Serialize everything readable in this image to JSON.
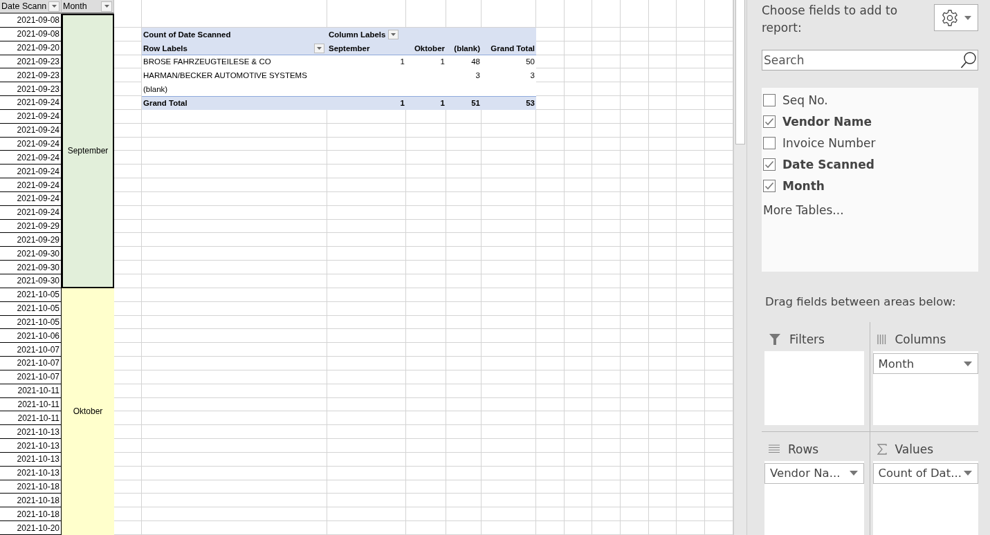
{
  "sheet": {
    "headers": [
      {
        "label": "Date Scann",
        "filter": true
      },
      {
        "label": "Month",
        "filter": true
      }
    ],
    "month_groups": [
      {
        "label": "September",
        "color": "#e2efda",
        "selected": true,
        "dates": [
          "2021-09-08",
          "2021-09-08",
          "2021-09-20",
          "2021-09-23",
          "2021-09-23",
          "2021-09-23",
          "2021-09-24",
          "2021-09-24",
          "2021-09-24",
          "2021-09-24",
          "2021-09-24",
          "2021-09-24",
          "2021-09-24",
          "2021-09-24",
          "2021-09-24",
          "2021-09-29",
          "2021-09-29",
          "2021-09-30",
          "2021-09-30",
          "2021-09-30"
        ]
      },
      {
        "label": "Oktober",
        "color": "#ffffcc",
        "selected": false,
        "dates": [
          "2021-10-05",
          "2021-10-05",
          "2021-10-05",
          "2021-10-06",
          "2021-10-07",
          "2021-10-07",
          "2021-10-07",
          "2021-10-11",
          "2021-10-11",
          "2021-10-11",
          "2021-10-13",
          "2021-10-13",
          "2021-10-13",
          "2021-10-13",
          "2021-10-18",
          "2021-10-18",
          "2021-10-18",
          "2021-10-20"
        ]
      }
    ]
  },
  "pivot": {
    "title": "Count of Date Scanned",
    "column_labels": "Column Labels",
    "row_labels": "Row Labels",
    "columns": [
      "September",
      "Oktober",
      "(blank)",
      "Grand Total"
    ],
    "rows": [
      {
        "label": "BROSE FAHRZEUGTEILESE & CO",
        "values": [
          "1",
          "1",
          "48",
          "50"
        ]
      },
      {
        "label": "HARMAN/BECKER AUTOMOTIVE SYSTEMS",
        "values": [
          "3",
          "3"
        ]
      },
      {
        "label": "(blank)"
      }
    ],
    "grand_total": {
      "label": "Grand Total",
      "values": [
        "1",
        "1",
        "51",
        "53"
      ]
    }
  },
  "field_list": {
    "heading": "Choose fields to add to report:",
    "search": {
      "placeholder": "Search"
    },
    "fields": [
      {
        "label": "Seq No.",
        "checked": false
      },
      {
        "label": "Vendor Name",
        "checked": true
      },
      {
        "label": "Invoice Number",
        "checked": false
      },
      {
        "label": "Date Scanned",
        "checked": true
      },
      {
        "label": "Month",
        "checked": true
      }
    ],
    "more_tables": "More Tables...",
    "drag_hint": "Drag fields between areas below:",
    "areas": [
      {
        "kind": "filters",
        "label": "Filters"
      },
      {
        "kind": "columns",
        "label": "Columns",
        "items": [
          "Month"
        ]
      },
      {
        "kind": "rows",
        "label": "Rows",
        "items": [
          "Vendor Na..."
        ]
      },
      {
        "kind": "values",
        "label": "Values",
        "items": [
          "Count of Dat..."
        ]
      }
    ]
  }
}
